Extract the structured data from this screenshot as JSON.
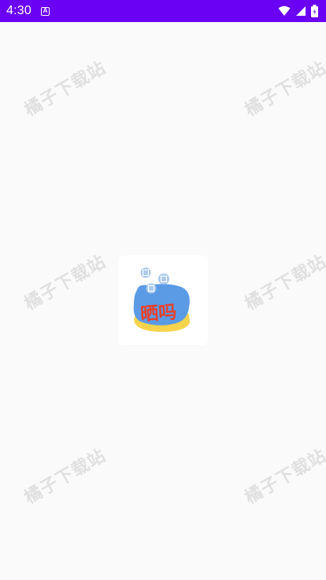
{
  "status_bar": {
    "time": "4:30",
    "badge_letter": "A",
    "icons": [
      "wifi-icon",
      "signal-icon",
      "battery-icon"
    ]
  },
  "watermark": {
    "text": "橘子下载站"
  },
  "app": {
    "logo_text": "晒吗"
  },
  "colors": {
    "status_bar": "#6a00f4",
    "background": "#fafafa",
    "logo_blue": "#5b9be6",
    "logo_yellow": "#f7d44c",
    "logo_red": "#e8402a"
  }
}
